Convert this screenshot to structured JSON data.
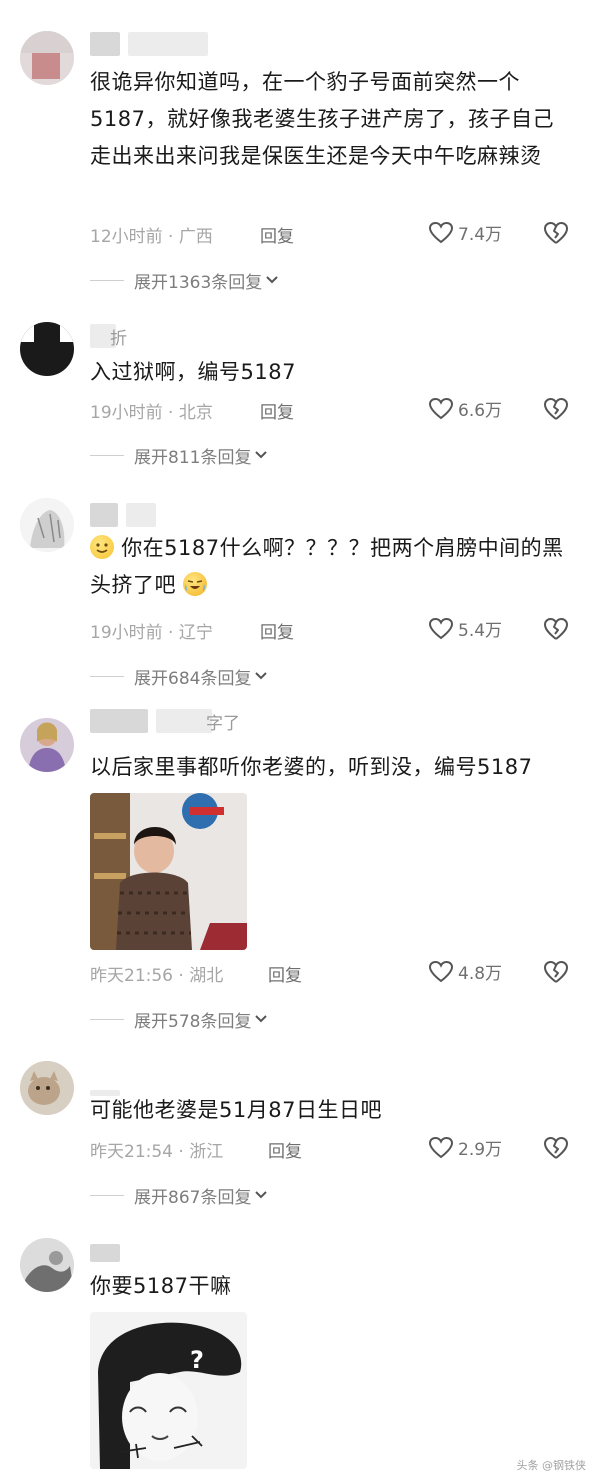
{
  "colors": {
    "background": "#ffffff",
    "text_primary": "#1a1a1a",
    "text_meta": "#a6a6a6",
    "text_action": "#6f6f6f"
  },
  "icons": {
    "like": "heart-outline-icon",
    "dislike": "broken-heart-icon",
    "expand": "chevron-down-icon"
  },
  "reply_label": "回复",
  "comments": [
    {
      "username": "",
      "text": "很诡异你知道吗，在一个豹子号面前突然一个5187，就好像我老婆生孩子进产房了，孩子自己走出来出来问我是保医生还是今天中午吃麻辣烫",
      "time_location": "12小时前 · 广西",
      "likes": "7.4万",
      "expand": "展开1363条回复"
    },
    {
      "username": "折",
      "text": "入过狱啊，编号5187",
      "time_location": "19小时前 · 北京",
      "likes": "6.6万",
      "expand": "展开811条回复"
    },
    {
      "username": "",
      "text_before": "你在5187什么啊？？？？把两个肩膀中间的黑头挤了吧",
      "time_location": "19小时前 · 辽宁",
      "likes": "5.4万",
      "expand": "展开684条回复"
    },
    {
      "username": "字了",
      "text": "以后家里事都听你老婆的，听到没，编号5187",
      "time_location": "昨天21:56 · 湖北",
      "likes": "4.8万",
      "expand": "展开578条回复"
    },
    {
      "username": "",
      "text": "可能他老婆是51月87日生日吧",
      "time_location": "昨天21:54 · 浙江",
      "likes": "2.9万",
      "expand": "展开867条回复"
    },
    {
      "username": "",
      "text": "你要5187干嘛"
    }
  ],
  "meme_question_mark": "?",
  "watermark": "头条 @钢铁侠"
}
